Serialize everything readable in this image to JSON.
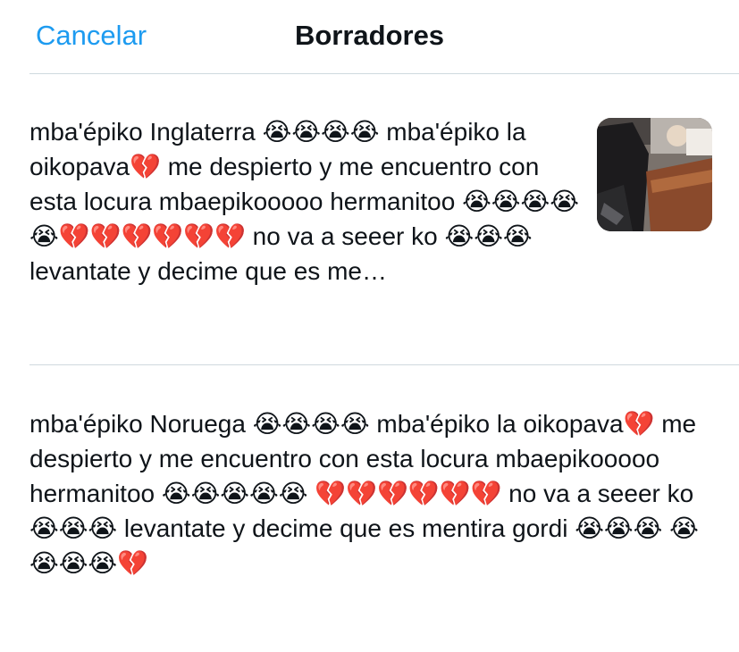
{
  "header": {
    "cancel_label": "Cancelar",
    "title": "Borradores"
  },
  "drafts": [
    {
      "text": "mba'épiko Inglaterra 😭😭😭😭 mba'épiko la oikopava💔 me despierto y me encuentro con esta locura mbaepikooooo hermanitoo 😭😭😭😭 😭💔💔💔💔💔💔 no va a seeer ko 😭😭😭 levantate y decime que es me…",
      "has_media": true
    },
    {
      "text": "mba'épiko Noruega 😭😭😭😭 mba'épiko la oikopava💔 me despierto y me encuentro con esta locura mbaepikooooo hermanitoo 😭😭😭😭😭 💔💔💔💔💔💔 no va a seeer ko 😭😭😭 levantate y decime que es mentira gordi 😭😭😭 😭😭😭😭💔",
      "has_media": false
    }
  ]
}
